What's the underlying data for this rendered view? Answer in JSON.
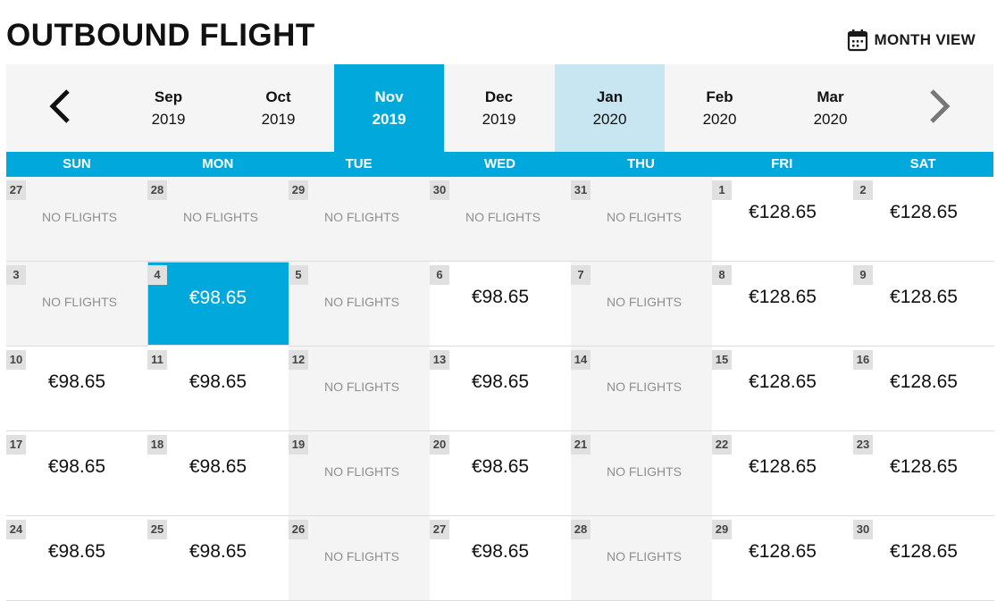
{
  "header": {
    "title": "OUTBOUND FLIGHT",
    "month_view_label": "MONTH VIEW",
    "month_view_icon": "calendar-icon"
  },
  "navigation": {
    "prev_icon": "chevron-left-icon",
    "next_icon": "chevron-right-icon"
  },
  "months": [
    {
      "month": "Sep",
      "year": "2019",
      "state": "normal"
    },
    {
      "month": "Oct",
      "year": "2019",
      "state": "normal"
    },
    {
      "month": "Nov",
      "year": "2019",
      "state": "selected"
    },
    {
      "month": "Dec",
      "year": "2019",
      "state": "normal"
    },
    {
      "month": "Jan",
      "year": "2020",
      "state": "highlight"
    },
    {
      "month": "Feb",
      "year": "2020",
      "state": "normal"
    },
    {
      "month": "Mar",
      "year": "2020",
      "state": "normal"
    }
  ],
  "weekdays": [
    "SUN",
    "MON",
    "TUE",
    "WED",
    "THU",
    "FRI",
    "SAT"
  ],
  "no_flights_label": "NO FLIGHTS",
  "colors": {
    "accent": "#00a8db",
    "highlight": "#c7e6f1",
    "no_flights_bg": "#f4f4f4",
    "day_badge_bg": "#e0e0e0"
  },
  "weeks": [
    [
      {
        "day": "27",
        "price": null
      },
      {
        "day": "28",
        "price": null
      },
      {
        "day": "29",
        "price": null
      },
      {
        "day": "30",
        "price": null
      },
      {
        "day": "31",
        "price": null
      },
      {
        "day": "1",
        "price": "€128.65"
      },
      {
        "day": "2",
        "price": "€128.65"
      }
    ],
    [
      {
        "day": "3",
        "price": null
      },
      {
        "day": "4",
        "price": "€98.65",
        "selected": true
      },
      {
        "day": "5",
        "price": null
      },
      {
        "day": "6",
        "price": "€98.65"
      },
      {
        "day": "7",
        "price": null
      },
      {
        "day": "8",
        "price": "€128.65"
      },
      {
        "day": "9",
        "price": "€128.65"
      }
    ],
    [
      {
        "day": "10",
        "price": "€98.65"
      },
      {
        "day": "11",
        "price": "€98.65"
      },
      {
        "day": "12",
        "price": null
      },
      {
        "day": "13",
        "price": "€98.65"
      },
      {
        "day": "14",
        "price": null
      },
      {
        "day": "15",
        "price": "€128.65"
      },
      {
        "day": "16",
        "price": "€128.65"
      }
    ],
    [
      {
        "day": "17",
        "price": "€98.65"
      },
      {
        "day": "18",
        "price": "€98.65"
      },
      {
        "day": "19",
        "price": null
      },
      {
        "day": "20",
        "price": "€98.65"
      },
      {
        "day": "21",
        "price": null
      },
      {
        "day": "22",
        "price": "€128.65"
      },
      {
        "day": "23",
        "price": "€128.65"
      }
    ],
    [
      {
        "day": "24",
        "price": "€98.65"
      },
      {
        "day": "25",
        "price": "€98.65"
      },
      {
        "day": "26",
        "price": null
      },
      {
        "day": "27",
        "price": "€98.65"
      },
      {
        "day": "28",
        "price": null
      },
      {
        "day": "29",
        "price": "€128.65"
      },
      {
        "day": "30",
        "price": "€128.65"
      }
    ]
  ]
}
